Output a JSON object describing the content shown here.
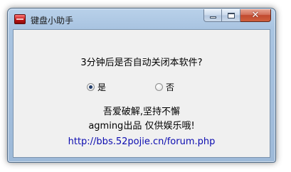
{
  "window": {
    "title": "键盘小助手",
    "close_symbol": "✕",
    "icons": [
      "app-icon",
      "minimize-icon",
      "maximize-icon",
      "close-icon"
    ]
  },
  "dialog": {
    "prompt": "3分钟后是否自动关闭本软件?",
    "options": [
      {
        "label": "是",
        "selected": true
      },
      {
        "label": "否",
        "selected": false
      }
    ],
    "slogan": "吾爱破解,坚持不懈",
    "credit": "agming出品 仅供娱乐哦!",
    "link": "http://bbs.52pojie.cn/forum.php"
  },
  "colors": {
    "link": "#0b0bb0",
    "frame": "#a9c4e1",
    "client_bg": "#f0f0f0",
    "close_button": "#c14a30"
  }
}
